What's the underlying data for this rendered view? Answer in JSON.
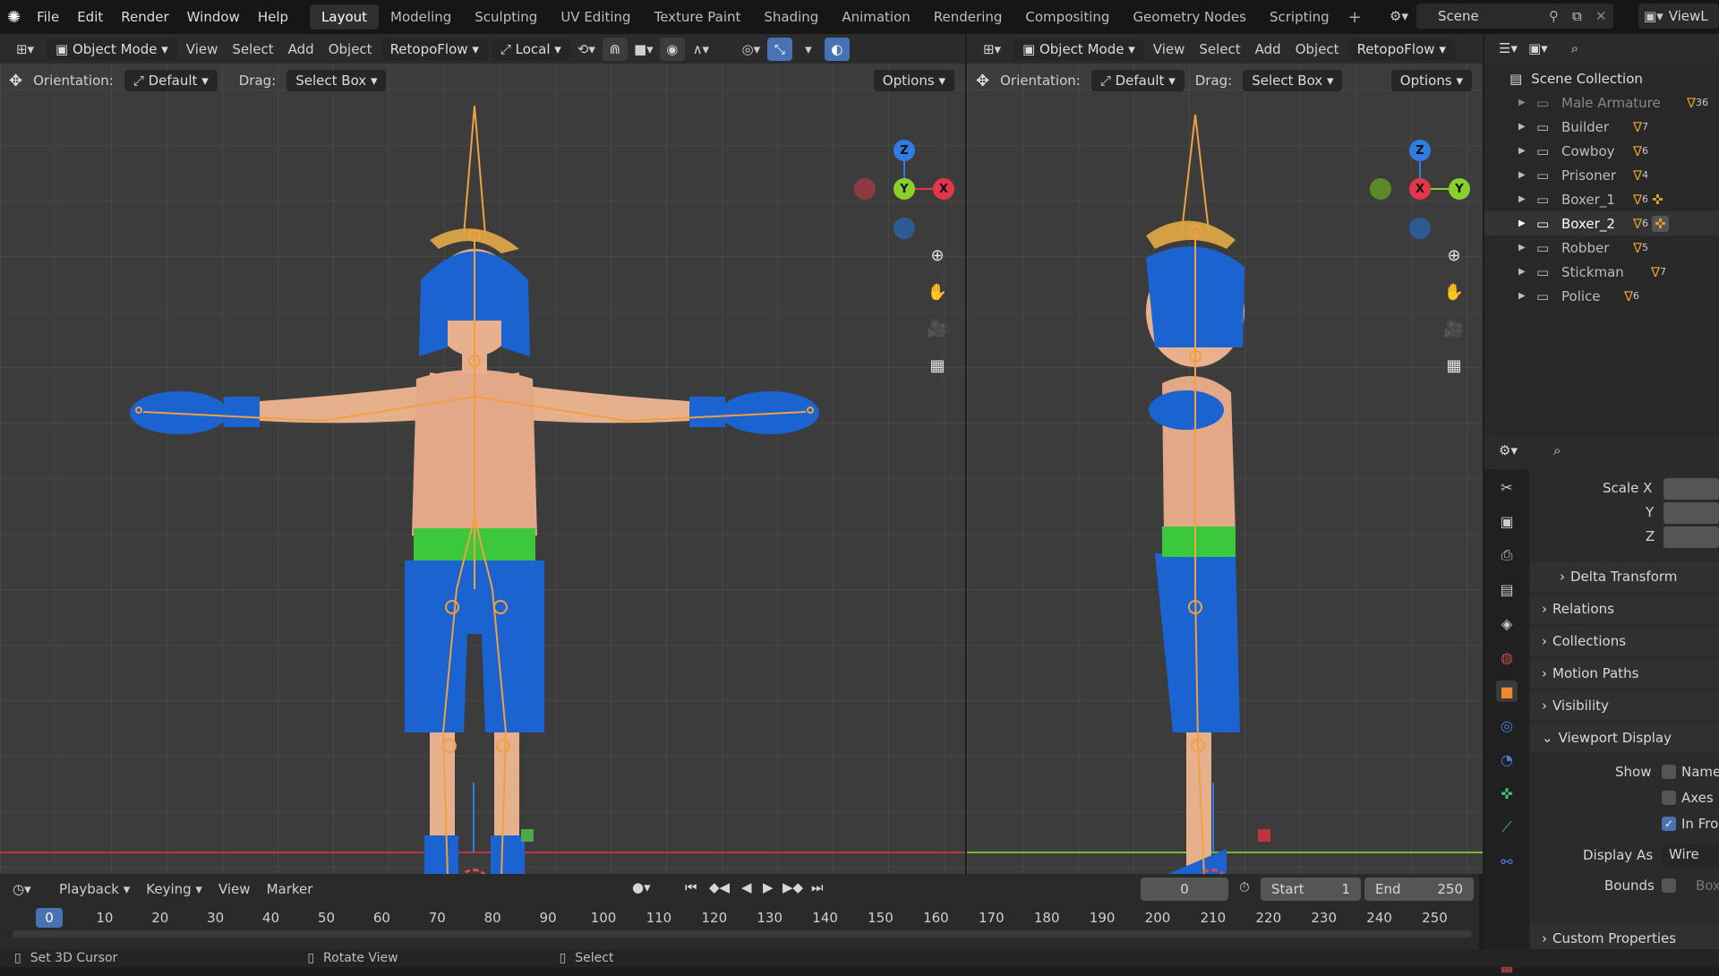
{
  "app": {
    "logo": "blender-logo-icon"
  },
  "menu": [
    "File",
    "Edit",
    "Render",
    "Window",
    "Help"
  ],
  "workspaces": [
    "Layout",
    "Modeling",
    "Sculpting",
    "UV Editing",
    "Texture Paint",
    "Shading",
    "Animation",
    "Rendering",
    "Compositing",
    "Geometry Nodes",
    "Scripting"
  ],
  "active_workspace": "Layout",
  "scene": {
    "name": "Scene",
    "view_layer": "ViewL"
  },
  "viewport_left": {
    "mode": "Object Mode",
    "menus": [
      "View",
      "Select",
      "Add",
      "Object"
    ],
    "addon": "RetopoFlow",
    "transform_space": "Local",
    "orientation_label": "Orientation:",
    "orientation": "Default",
    "drag_label": "Drag:",
    "drag": "Select Box",
    "options": "Options"
  },
  "viewport_right": {
    "mode": "Object Mode",
    "menus": [
      "View",
      "Select",
      "Add",
      "Object"
    ],
    "addon": "RetopoFlow",
    "orientation_label": "Orientation:",
    "orientation": "Default",
    "drag_label": "Drag:",
    "drag": "Select Box",
    "options": "Options"
  },
  "gizmo_left": {
    "z": "Z",
    "y": "Y",
    "x": "X"
  },
  "gizmo_right": {
    "z": "Z",
    "x": "X",
    "y": "Y"
  },
  "outliner": {
    "title": "Scene Collection",
    "items": [
      {
        "name": "Male Armature",
        "count": "36"
      },
      {
        "name": "Builder",
        "count": "7"
      },
      {
        "name": "Cowboy",
        "count": "6"
      },
      {
        "name": "Prisoner",
        "count": "4"
      },
      {
        "name": "Boxer_1",
        "count": "6"
      },
      {
        "name": "Boxer_2",
        "count": "6"
      },
      {
        "name": "Robber",
        "count": "5"
      },
      {
        "name": "Stickman",
        "count": "7"
      },
      {
        "name": "Police",
        "count": "6"
      }
    ]
  },
  "properties": {
    "scale_x": "Scale X",
    "y": "Y",
    "z": "Z",
    "panels": [
      "Delta Transform",
      "Relations",
      "Collections",
      "Motion Paths",
      "Visibility",
      "Viewport Display"
    ],
    "show_label": "Show",
    "show_options": [
      "Name",
      "Axes",
      "In Fro"
    ],
    "display_as_label": "Display As",
    "display_as": "Wire",
    "bounds_label": "Bounds",
    "bounds_value": "Box",
    "custom_properties": "Custom Properties"
  },
  "timeline": {
    "menus": [
      "Playback",
      "Keying",
      "View",
      "Marker"
    ],
    "current_frame": "0",
    "start_label": "Start",
    "start": "1",
    "end_label": "End",
    "end": "250",
    "ticks": [
      "0",
      "10",
      "20",
      "30",
      "40",
      "50",
      "60",
      "70",
      "80",
      "90",
      "100",
      "110",
      "120",
      "130",
      "140",
      "150",
      "160",
      "170",
      "180",
      "190",
      "200",
      "210",
      "220",
      "230",
      "240",
      "250"
    ]
  },
  "status": {
    "left": "Set 3D Cursor",
    "middle": "Rotate View",
    "right": "Select"
  },
  "colors": {
    "accent": "#4772b3",
    "bone": "#f0a040",
    "helmet": "#1a63d1",
    "belt": "#3cc83c",
    "x_axis": "#e3364a",
    "y_axis": "#8ad02c",
    "z_axis": "#2f7de0"
  }
}
